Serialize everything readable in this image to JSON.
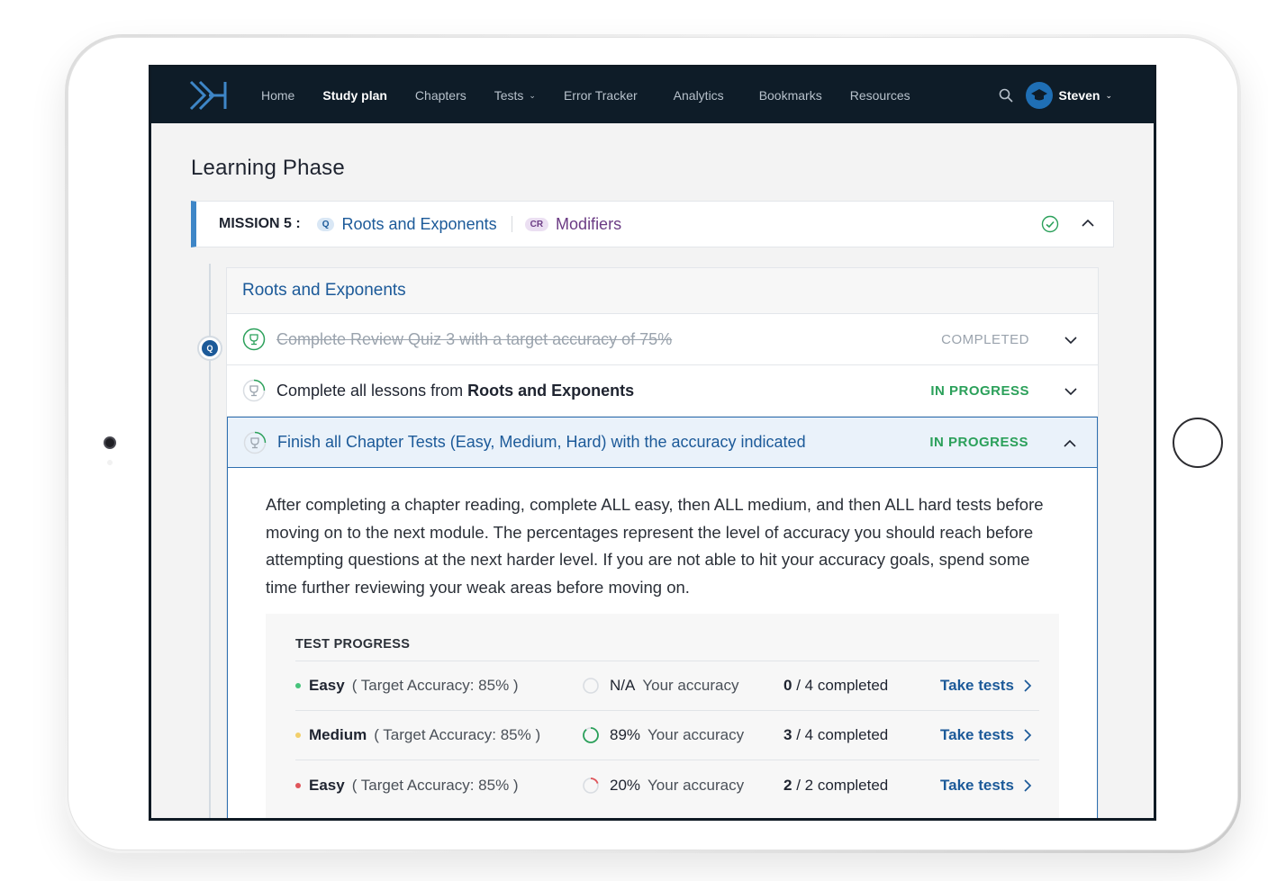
{
  "nav": {
    "items": [
      "Home",
      "Study plan",
      "Chapters",
      "Tests",
      "Error Tracker",
      "Analytics",
      "Bookmarks",
      "Resources"
    ],
    "active": "Study plan",
    "user": "Steven"
  },
  "page": {
    "title": "Learning Phase"
  },
  "mission": {
    "label": "MISSION 5 :",
    "topics": [
      {
        "tag": "Q",
        "name": "Roots and Exponents"
      },
      {
        "tag": "CR",
        "name": "Modifiers"
      }
    ]
  },
  "topic": {
    "tag": "Q",
    "title": "Roots and Exponents",
    "tasks": [
      {
        "text": "Complete Review Quiz 3 with a target accuracy of 75%",
        "status": "COMPLETED"
      },
      {
        "text_prefix": "Complete all lessons from ",
        "text_bold": "Roots and Exponents",
        "status": "IN PROGRESS"
      },
      {
        "text": "Finish all Chapter Tests (Easy, Medium, Hard) with the accuracy indicated",
        "status": "IN PROGRESS"
      }
    ],
    "description": "After completing a chapter reading, complete ALL easy, then ALL medium, and then ALL hard tests before moving on to the next module. The percentages represent the level of accuracy you should reach before attempting questions at the next harder level. If you are not able to hit your accuracy goals, spend some time further reviewing your weak areas before moving on.",
    "test_progress": {
      "title": "TEST PROGRESS",
      "rows": [
        {
          "level": "Easy",
          "target": "( Target Accuracy: 85% )",
          "accuracy": "N/A",
          "accuracy_label": "Your accuracy",
          "done": "0",
          "total": "/ 4 completed",
          "action": "Take tests",
          "dot_color": "#46c37b"
        },
        {
          "level": "Medium",
          "target": "( Target Accuracy: 85% )",
          "accuracy": "89%",
          "accuracy_label": "Your accuracy",
          "done": "3",
          "total": "/ 4 completed",
          "action": "Take tests",
          "dot_color": "#f2cf6b"
        },
        {
          "level": "Easy",
          "target": "( Target Accuracy: 85% )",
          "accuracy": "20%",
          "accuracy_label": "Your accuracy",
          "done": "2",
          "total": "/ 2 completed",
          "action": "Take tests",
          "dot_color": "#e0565b"
        }
      ]
    }
  }
}
